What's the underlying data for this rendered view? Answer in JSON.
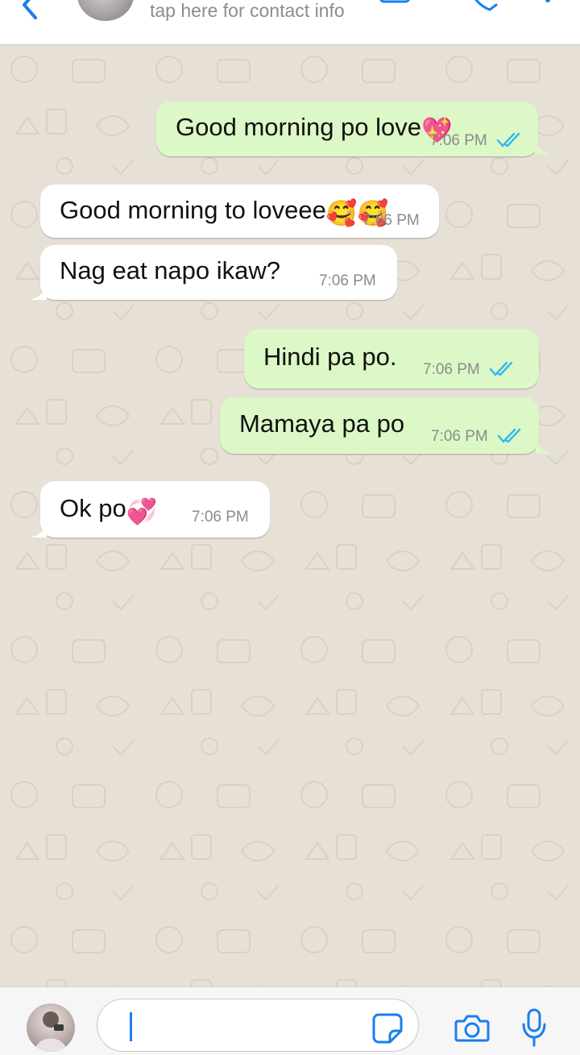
{
  "header": {
    "subtitle": "tap here for contact info"
  },
  "messages": [
    {
      "direction": "outgoing",
      "text": "Good morning po love",
      "emoji": "💖",
      "time": "7:06 PM",
      "status": "read"
    },
    {
      "direction": "incoming",
      "text": "Good morning to loveee",
      "emoji": "🥰🥰",
      "time": "7:06 PM"
    },
    {
      "direction": "incoming",
      "text": "Nag eat napo ikaw?",
      "time": "7:06 PM"
    },
    {
      "direction": "outgoing",
      "text": "Hindi pa po.",
      "time": "7:06 PM",
      "status": "read"
    },
    {
      "direction": "outgoing",
      "text": "Mamaya pa po",
      "time": "7:06 PM",
      "status": "read"
    },
    {
      "direction": "incoming",
      "text": "Ok po",
      "emoji": "💞",
      "time": "7:06 PM"
    }
  ],
  "input": {
    "value": ""
  },
  "colors": {
    "accent": "#1a7ef0",
    "outgoing_bubble": "#dcf8c6",
    "incoming_bubble": "#ffffff",
    "read_ticks": "#34b7f1",
    "wallpaper": "#e6e0d6"
  },
  "icons": [
    "back-icon",
    "video-call-icon",
    "voice-call-icon",
    "more-icon",
    "sticker-icon",
    "camera-icon",
    "microphone-icon"
  ]
}
